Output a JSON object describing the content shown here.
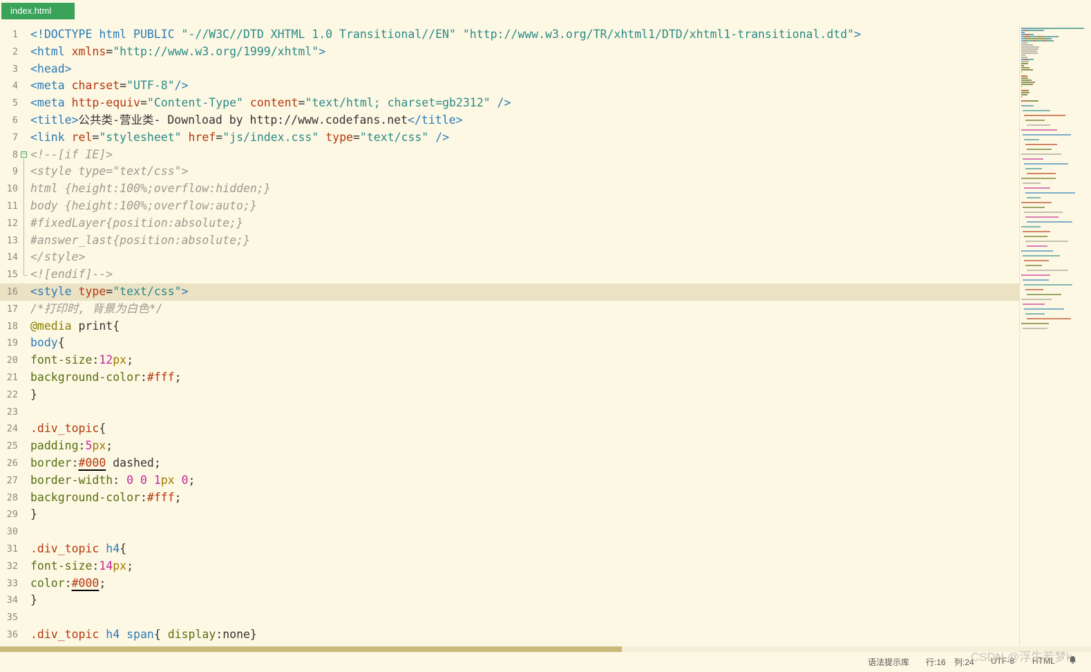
{
  "tab": {
    "label": "index.html"
  },
  "editor": {
    "current_line": 16,
    "lines": [
      [
        [
          "t",
          "<!DOCTYPE html PUBLIC "
        ],
        [
          "s",
          "\"-//W3C//DTD XHTML 1.0 Transitional//EN\""
        ],
        [
          "p",
          " "
        ],
        [
          "s",
          "\"http://www.w3.org/TR/xhtml1/DTD/xhtml1-transitional.dtd\""
        ],
        [
          "t",
          ">"
        ]
      ],
      [
        [
          "t",
          "<html "
        ],
        [
          "a",
          "xmlns"
        ],
        [
          "p",
          "="
        ],
        [
          "s",
          "\"http://www.w3.org/1999/xhtml\""
        ],
        [
          "t",
          ">"
        ]
      ],
      [
        [
          "t",
          "<head>"
        ]
      ],
      [
        [
          "t",
          "<meta "
        ],
        [
          "a",
          "charset"
        ],
        [
          "p",
          "="
        ],
        [
          "s",
          "\"UTF-8\""
        ],
        [
          "t",
          "/>"
        ]
      ],
      [
        [
          "t",
          "<meta "
        ],
        [
          "a",
          "http-equiv"
        ],
        [
          "p",
          "="
        ],
        [
          "s",
          "\"Content-Type\""
        ],
        [
          "p",
          " "
        ],
        [
          "a",
          "content"
        ],
        [
          "p",
          "="
        ],
        [
          "s",
          "\"text/html; charset=gb2312\""
        ],
        [
          "p",
          " "
        ],
        [
          "t",
          "/>"
        ]
      ],
      [
        [
          "t",
          "<title>"
        ],
        [
          "x",
          "公共类-营业类- Download by http://www.codefans.net"
        ],
        [
          "t",
          "</title>"
        ]
      ],
      [
        [
          "t",
          "<link "
        ],
        [
          "a",
          "rel"
        ],
        [
          "p",
          "="
        ],
        [
          "s",
          "\"stylesheet\""
        ],
        [
          "p",
          " "
        ],
        [
          "a",
          "href"
        ],
        [
          "p",
          "="
        ],
        [
          "s",
          "\"js/index.css\""
        ],
        [
          "p",
          " "
        ],
        [
          "a",
          "type"
        ],
        [
          "p",
          "="
        ],
        [
          "s",
          "\"text/css\""
        ],
        [
          "p",
          " "
        ],
        [
          "t",
          "/>"
        ]
      ],
      [
        [
          "c",
          "<!--[if IE]>"
        ]
      ],
      [
        [
          "c",
          "<style type=\"text/css\">"
        ]
      ],
      [
        [
          "c",
          "html {height:100%;overflow:hidden;}"
        ]
      ],
      [
        [
          "c",
          "body {height:100%;overflow:auto;}"
        ]
      ],
      [
        [
          "c",
          "#fixedLayer{position:absolute;}"
        ]
      ],
      [
        [
          "c",
          "#answer_last{position:absolute;}"
        ]
      ],
      [
        [
          "c",
          "</style>"
        ]
      ],
      [
        [
          "c",
          "<![endif]-->"
        ]
      ],
      [
        [
          "t",
          "<style "
        ],
        [
          "a",
          "type"
        ],
        [
          "p",
          "="
        ],
        [
          "s",
          "\"text/css\""
        ],
        [
          "t",
          ">"
        ]
      ],
      [
        [
          "c",
          "/*打印时, 背景为白色*/"
        ]
      ],
      [
        [
          "at",
          "@media"
        ],
        [
          "pl",
          " print{"
        ]
      ],
      [
        [
          "sel",
          "body"
        ],
        [
          "pl",
          "{"
        ]
      ],
      [
        [
          "pr",
          "font-size"
        ],
        [
          "pl",
          ":"
        ],
        [
          "n",
          "12"
        ],
        [
          "u",
          "px"
        ],
        [
          "pl",
          ";"
        ]
      ],
      [
        [
          "pr",
          "background-color"
        ],
        [
          "pl",
          ":"
        ],
        [
          "col",
          "#fff"
        ],
        [
          "pl",
          ";"
        ]
      ],
      [
        [
          "pl",
          "}"
        ]
      ],
      [],
      [
        [
          "cls",
          ".div_topic"
        ],
        [
          "pl",
          "{"
        ]
      ],
      [
        [
          "pr",
          "padding"
        ],
        [
          "pl",
          ":"
        ],
        [
          "n",
          "5"
        ],
        [
          "u",
          "px"
        ],
        [
          "pl",
          ";"
        ]
      ],
      [
        [
          "pr",
          "border"
        ],
        [
          "pl",
          ":"
        ],
        [
          "colu",
          "#000"
        ],
        [
          "pl",
          " dashed;"
        ]
      ],
      [
        [
          "pr",
          "border-width"
        ],
        [
          "pl",
          ": "
        ],
        [
          "n",
          "0"
        ],
        [
          "pl",
          " "
        ],
        [
          "n",
          "0"
        ],
        [
          "pl",
          " "
        ],
        [
          "n",
          "1"
        ],
        [
          "u",
          "px"
        ],
        [
          "pl",
          " "
        ],
        [
          "n",
          "0"
        ],
        [
          "pl",
          ";"
        ]
      ],
      [
        [
          "pr",
          "background-color"
        ],
        [
          "pl",
          ":"
        ],
        [
          "col",
          "#fff"
        ],
        [
          "pl",
          ";"
        ]
      ],
      [
        [
          "pl",
          "}"
        ]
      ],
      [],
      [
        [
          "cls",
          ".div_topic"
        ],
        [
          "pl",
          " "
        ],
        [
          "sel",
          "h4"
        ],
        [
          "pl",
          "{"
        ]
      ],
      [
        [
          "pr",
          "font-size"
        ],
        [
          "pl",
          ":"
        ],
        [
          "n",
          "14"
        ],
        [
          "u",
          "px"
        ],
        [
          "pl",
          ";"
        ]
      ],
      [
        [
          "pr",
          "color"
        ],
        [
          "pl",
          ":"
        ],
        [
          "colu",
          "#000"
        ],
        [
          "pl",
          ";"
        ]
      ],
      [
        [
          "pl",
          "}"
        ]
      ],
      [],
      [
        [
          "cls",
          ".div_topic"
        ],
        [
          "pl",
          " "
        ],
        [
          "sel",
          "h4"
        ],
        [
          "pl",
          " "
        ],
        [
          "sel",
          "span"
        ],
        [
          "pl",
          "{ "
        ],
        [
          "pr",
          "display"
        ],
        [
          "pl",
          ":none}"
        ]
      ]
    ]
  },
  "status": {
    "syntax_hint": "语法提示库",
    "row": "行:16",
    "col": "列:24",
    "encoding": "UTF-8",
    "language": "HTML"
  },
  "watermark": "CSDN @浮生若梦k",
  "colors": {
    "tab_bg": "#3aa35a",
    "editor_bg": "#fdf8e3",
    "current_line": "#ebe1c3",
    "scroll_thumb": "#c9b97a"
  }
}
